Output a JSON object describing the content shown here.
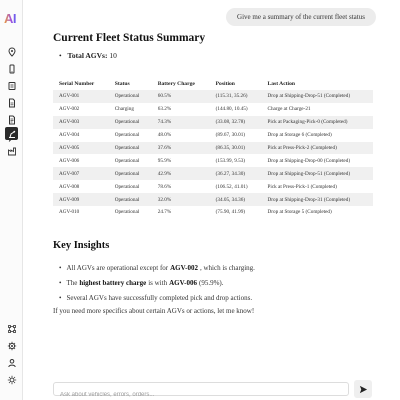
{
  "app": {
    "logo_text": "AI"
  },
  "sidebar": {
    "top_items": [
      {
        "icon": "map-pin-icon"
      },
      {
        "icon": "phone-icon"
      },
      {
        "icon": "list-icon"
      },
      {
        "icon": "document-icon"
      },
      {
        "icon": "document-lines-icon"
      },
      {
        "icon": "chat-icon"
      },
      {
        "icon": "robot-arm-icon",
        "active": true
      },
      {
        "icon": "factory-icon"
      }
    ],
    "bottom_items": [
      {
        "icon": "nodes-icon"
      },
      {
        "icon": "gear-icon"
      },
      {
        "icon": "user-icon"
      },
      {
        "icon": "sun-icon"
      }
    ]
  },
  "chat": {
    "user_message": "Give me a summary of the current fleet status"
  },
  "summary": {
    "title": "Current Fleet Status Summary",
    "total_label": "Total AGVs:",
    "total_value": "10",
    "table": {
      "headers": [
        "Serial Number",
        "Status",
        "Battery Charge",
        "Position",
        "Last Action"
      ],
      "rows": [
        [
          "AGV-001",
          "Operational",
          "60.5%",
          "(115.31, 35.26)",
          "Drop at Shipping-Drop-51 (Completed)"
        ],
        [
          "AGV-002",
          "Charging",
          "63.2%",
          "(144.80, 10.45)",
          "Charge at Charge-21"
        ],
        [
          "AGV-003",
          "Operational",
          "74.3%",
          "(33.08, 32.78)",
          "Pick at Packaging-Pick-0 (Completed)"
        ],
        [
          "AGV-004",
          "Operational",
          "48.0%",
          "(89.67, 30.01)",
          "Drop at Storage 6 (Completed)"
        ],
        [
          "AGV-005",
          "Operational",
          "37.6%",
          "(86.35, 30.01)",
          "Pick at Press-Pick-2 (Completed)"
        ],
        [
          "AGV-006",
          "Operational",
          "95.9%",
          "(153.99, 9.53)",
          "Drop at Shipping-Drop-00 (Completed)"
        ],
        [
          "AGV-007",
          "Operational",
          "42.9%",
          "(36.27, 34.30)",
          "Drop at Shipping-Drop-51 (Completed)"
        ],
        [
          "AGV-008",
          "Operational",
          "78.6%",
          "(106.52, 41.01)",
          "Pick at Press-Pick-1 (Completed)"
        ],
        [
          "AGV-009",
          "Operational",
          "32.0%",
          "(34.05, 34.36)",
          "Drop at Shipping-Drop-31 (Completed)"
        ],
        [
          "AGV-010",
          "Operational",
          "24.7%",
          "(75.90, 41.99)",
          "Drop at Storage 5 (Completed)"
        ]
      ]
    }
  },
  "insights": {
    "title": "Key Insights",
    "items": [
      {
        "pre": "All AGVs are operational except for",
        "bold": "AGV-002",
        "post": ", which is charging."
      },
      {
        "pre": "The",
        "bold": "highest battery charge",
        "post": "is with",
        "bold2": "AGV-006",
        "post2": "(95.9%)."
      },
      {
        "pre": "Several AGVs have successfully completed pick and drop actions."
      }
    ],
    "closing": "If you need more specifics about certain AGVs or actions, let me know!"
  },
  "composer": {
    "placeholder": "Ask about vehicles, errors, orders...",
    "value": "",
    "send_icon": "send-icon"
  }
}
